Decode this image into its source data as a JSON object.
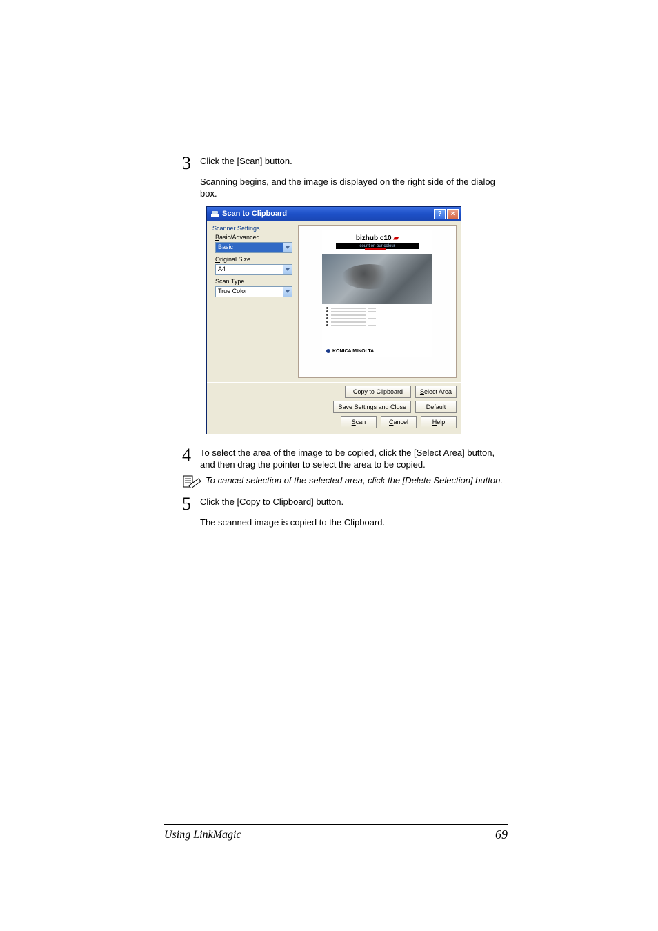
{
  "steps": {
    "s3": {
      "num": "3",
      "line1": "Click the [Scan] button.",
      "line2": "Scanning begins, and the image is displayed on the right side of the dialog box."
    },
    "s4": {
      "num": "4",
      "line1": "To select the area of the image to be copied, click the [Select Area] button, and then drag the pointer to select the area to be copied."
    },
    "note": {
      "text": "To cancel selection of the selected area, click the [Delete Selection] button."
    },
    "s5": {
      "num": "5",
      "line1": "Click the [Copy to Clipboard] button.",
      "line2": "The scanned image is copied to the Clipboard."
    }
  },
  "dialog": {
    "title": "Scan to Clipboard",
    "group": "Scanner Settings",
    "fields": {
      "basic_adv": {
        "label": "Basic/Advanced",
        "value": "Basic"
      },
      "orig_size": {
        "label": "Original Size",
        "value": "A4"
      },
      "scan_type": {
        "label": "Scan Type",
        "value": "True Color"
      }
    },
    "brochure": {
      "logo": "bizhub c10",
      "tagline": "count on our colour",
      "footer": "KONICA MINOLTA"
    },
    "buttons": {
      "copy": "Copy to Clipboard",
      "select_area": "Select Area",
      "save_close": "Save Settings and Close",
      "default": "Default",
      "scan": "Scan",
      "cancel": "Cancel",
      "help": "Help"
    }
  },
  "footer": {
    "left": "Using LinkMagic",
    "right": "69"
  }
}
